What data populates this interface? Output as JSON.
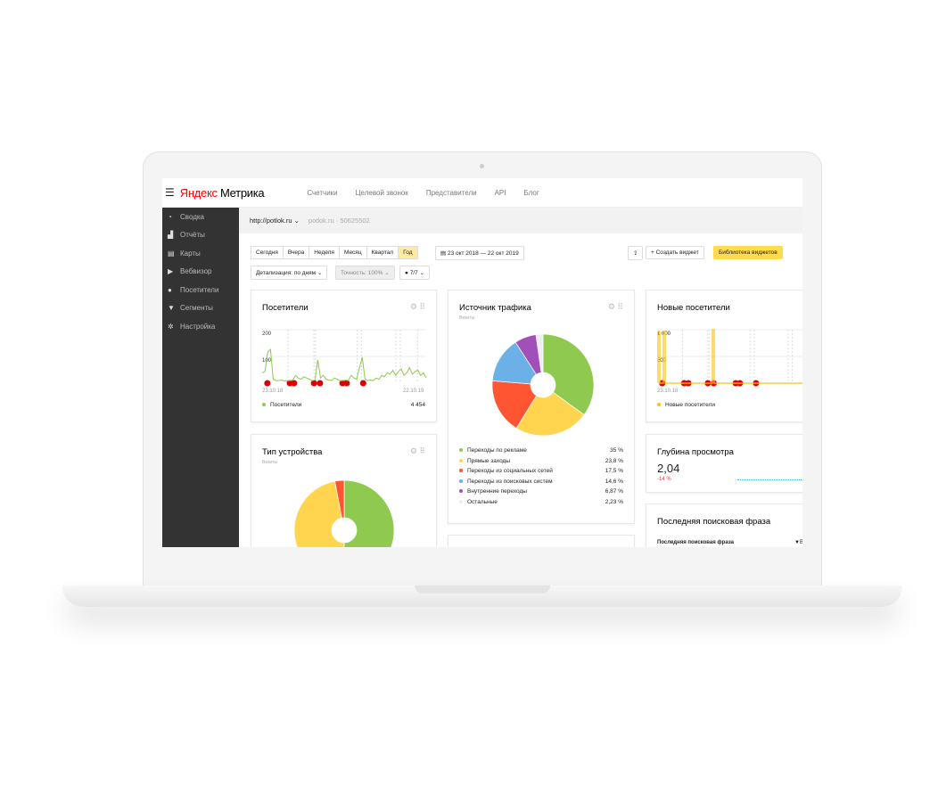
{
  "header": {
    "logo_brand": "Яндекс",
    "logo_product": "Метрика",
    "nav": [
      "Счетчики",
      "Целевой звонок",
      "Представители",
      "API",
      "Блог"
    ]
  },
  "sidebar": {
    "items": [
      {
        "icon": "gauge-icon",
        "label": "Сводка"
      },
      {
        "icon": "bar-chart-icon",
        "label": "Отчёты"
      },
      {
        "icon": "map-icon",
        "label": "Карты"
      },
      {
        "icon": "play-icon",
        "label": "Вебвизор"
      },
      {
        "icon": "person-icon",
        "label": "Посетители"
      },
      {
        "icon": "filter-icon",
        "label": "Сегменты"
      },
      {
        "icon": "gear-icon",
        "label": "Настройка"
      }
    ]
  },
  "subheader": {
    "site": "http://potlok.ru",
    "counter": "potlok.ru · 50625502"
  },
  "toolbar": {
    "periods": [
      "Сегодня",
      "Вчера",
      "Неделя",
      "Месяц",
      "Квартал",
      "Год"
    ],
    "active_period": "Год",
    "date_range": "23 окт 2018 — 22 окт 2019",
    "create_widget": "+ Создать виджет",
    "library": "Библиотека виджетов",
    "detail": "Детализация: по дням",
    "accuracy": "Точность: 100%",
    "segments": "7/7"
  },
  "colors": {
    "accent": "#ffdb4d",
    "green": "#8fc94f",
    "yellow": "#ffd54f",
    "red": "#ff5533",
    "blue": "#6bb0e6",
    "purple": "#a050b8",
    "other": "#eeeeee"
  },
  "widgets": {
    "visitors": {
      "title": "Посетители",
      "legend": "Посетители",
      "total": "4 454",
      "y_ticks": [
        "200",
        "100"
      ],
      "x_start": "23.10.18",
      "x_end": "22.10.19",
      "ymax": 220,
      "values": [
        40,
        45,
        120,
        130,
        15,
        10,
        10,
        12,
        8,
        10,
        10,
        12,
        30,
        20,
        15,
        25,
        20,
        15,
        10,
        12,
        90,
        20,
        30,
        15,
        12,
        10,
        20,
        15,
        10,
        10,
        12,
        10,
        30,
        20,
        15,
        60,
        100,
        15,
        10,
        12,
        10,
        20,
        15,
        30,
        25,
        40,
        35,
        50,
        30,
        45,
        55,
        30,
        40,
        60,
        35,
        45,
        50,
        30,
        40,
        20
      ]
    },
    "traffic": {
      "title": "Источник трафика",
      "note": "Визиты",
      "items": [
        {
          "label": "Переходы по рекламе",
          "value": 35,
          "text": "35 %",
          "color": "#8fc94f"
        },
        {
          "label": "Прямые заходы",
          "value": 23.8,
          "text": "23,8 %",
          "color": "#ffd54f"
        },
        {
          "label": "Переходы из социальных сетей",
          "value": 17.5,
          "text": "17,5 %",
          "color": "#ff5533"
        },
        {
          "label": "Переходы из поисковых систем",
          "value": 14.6,
          "text": "14,6 %",
          "color": "#6bb0e6"
        },
        {
          "label": "Внутренние переходы",
          "value": 6.87,
          "text": "6,87 %",
          "color": "#a050b8"
        },
        {
          "label": "Остальные",
          "value": 2.23,
          "text": "2,23 %",
          "color": "#eeeeee"
        }
      ]
    },
    "new_visitors": {
      "title": "Новые посетители",
      "legend": "Новые посетители",
      "y_ticks": [
        "1 000",
        "500"
      ],
      "x_start": "23.10.18"
    },
    "device": {
      "title": "Тип устройства",
      "note": "Визиты",
      "shares": [
        {
          "value": 50,
          "color": "#8fc94f"
        },
        {
          "value": 47,
          "color": "#ffd54f"
        },
        {
          "value": 3,
          "color": "#ff5533"
        }
      ]
    },
    "depth": {
      "title": "Глубина просмотра",
      "value": "2,04",
      "change": "-14 %"
    },
    "search": {
      "title": "Последняя поисковая фраза",
      "column": "Последняя поисковая фраза"
    }
  }
}
